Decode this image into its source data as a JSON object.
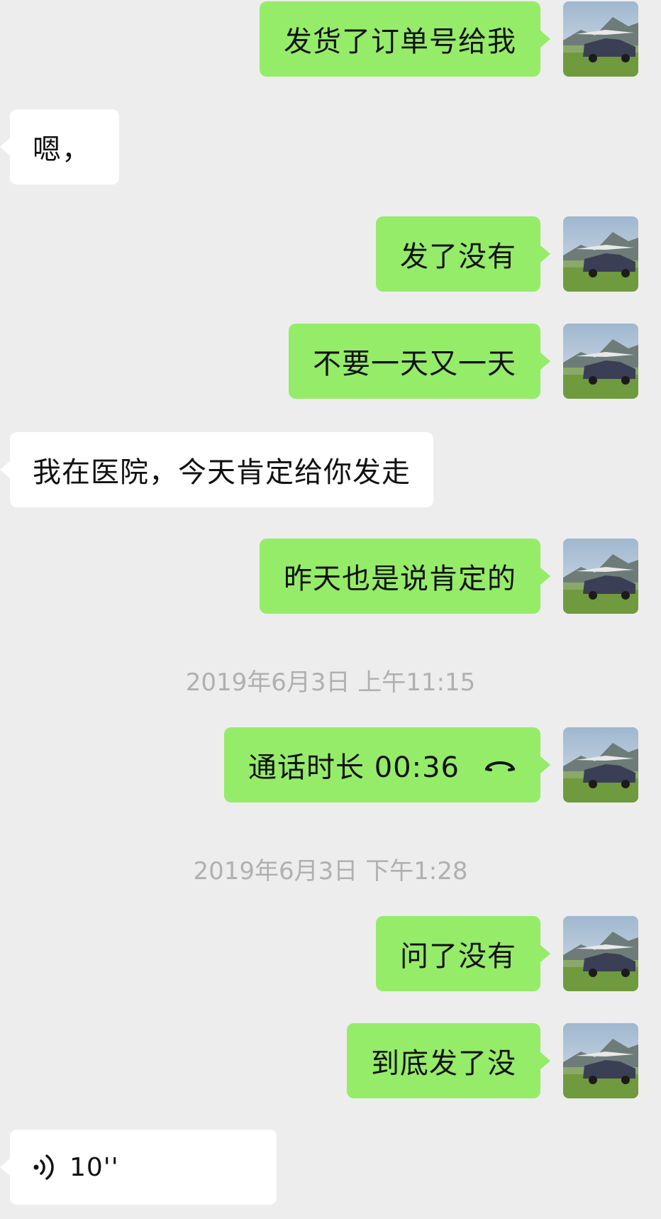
{
  "messages": [
    {
      "side": "out",
      "text": "发货了订单号给我"
    },
    {
      "side": "in",
      "text": "嗯，"
    },
    {
      "side": "out",
      "text": "发了没有"
    },
    {
      "side": "out",
      "text": "不要一天又一天"
    },
    {
      "side": "in",
      "text": "我在医院，今天肯定给你发走"
    },
    {
      "side": "out",
      "text": "昨天也是说肯定的"
    },
    {
      "timestamp": "2019年6月3日 上午11:15"
    },
    {
      "side": "out",
      "text": "通话时长 00:36",
      "icon": "phone-hangup-icon"
    },
    {
      "timestamp": "2019年6月3日 下午1:28"
    },
    {
      "side": "out",
      "text": "问了没有"
    },
    {
      "side": "out",
      "text": "到底发了没"
    },
    {
      "side": "in",
      "type": "voice",
      "text": "10''",
      "icon": "voice-wave-icon"
    }
  ],
  "colors": {
    "background": "#ededed",
    "outgoing_bubble": "#95ec69",
    "incoming_bubble": "#ffffff",
    "timestamp_text": "#b0b0b0"
  },
  "avatar_icon": "car-avatar"
}
